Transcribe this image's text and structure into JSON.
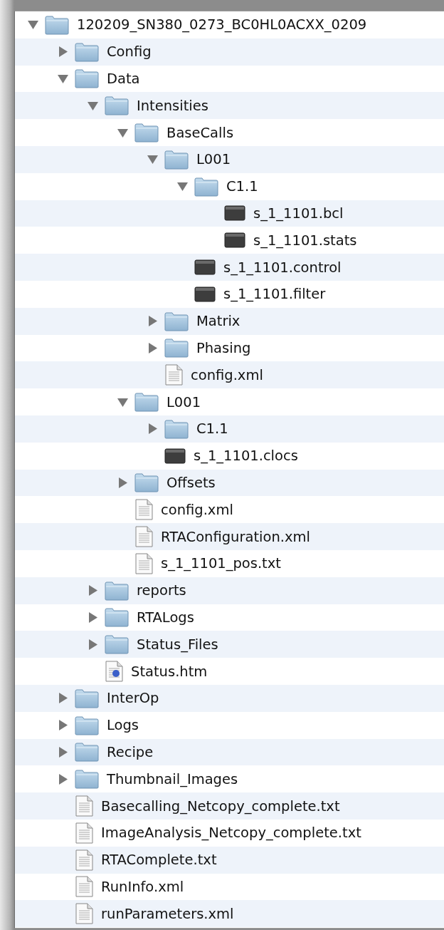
{
  "tree": [
    {
      "name": "120209_SN380_0273_BC0HL0ACXX_0209",
      "kind": "folder",
      "expanded": true,
      "children": [
        {
          "name": "Config",
          "kind": "folder",
          "expanded": false
        },
        {
          "name": "Data",
          "kind": "folder",
          "expanded": true,
          "children": [
            {
              "name": "Intensities",
              "kind": "folder",
              "expanded": true,
              "children": [
                {
                  "name": "BaseCalls",
                  "kind": "folder",
                  "expanded": true,
                  "children": [
                    {
                      "name": "L001",
                      "kind": "folder",
                      "expanded": true,
                      "children": [
                        {
                          "name": "C1.1",
                          "kind": "folder",
                          "expanded": true,
                          "children": [
                            {
                              "name": "s_1_1101.bcl",
                              "kind": "binary"
                            },
                            {
                              "name": "s_1_1101.stats",
                              "kind": "binary"
                            }
                          ]
                        },
                        {
                          "name": "s_1_1101.control",
                          "kind": "binary"
                        },
                        {
                          "name": "s_1_1101.filter",
                          "kind": "binary"
                        }
                      ]
                    },
                    {
                      "name": "Matrix",
                      "kind": "folder",
                      "expanded": false
                    },
                    {
                      "name": "Phasing",
                      "kind": "folder",
                      "expanded": false
                    },
                    {
                      "name": "config.xml",
                      "kind": "text"
                    }
                  ]
                },
                {
                  "name": "L001",
                  "kind": "folder",
                  "expanded": true,
                  "children": [
                    {
                      "name": "C1.1",
                      "kind": "folder",
                      "expanded": false
                    },
                    {
                      "name": "s_1_1101.clocs",
                      "kind": "binary"
                    }
                  ]
                },
                {
                  "name": "Offsets",
                  "kind": "folder",
                  "expanded": false
                },
                {
                  "name": "config.xml",
                  "kind": "text"
                },
                {
                  "name": "RTAConfiguration.xml",
                  "kind": "text"
                },
                {
                  "name": "s_1_1101_pos.txt",
                  "kind": "text"
                }
              ]
            },
            {
              "name": "reports",
              "kind": "folder",
              "expanded": false
            },
            {
              "name": "RTALogs",
              "kind": "folder",
              "expanded": false
            },
            {
              "name": "Status_Files",
              "kind": "folder",
              "expanded": false
            },
            {
              "name": "Status.htm",
              "kind": "web"
            }
          ]
        },
        {
          "name": "InterOp",
          "kind": "folder",
          "expanded": false
        },
        {
          "name": "Logs",
          "kind": "folder",
          "expanded": false
        },
        {
          "name": "Recipe",
          "kind": "folder",
          "expanded": false
        },
        {
          "name": "Thumbnail_Images",
          "kind": "folder",
          "expanded": false
        },
        {
          "name": "Basecalling_Netcopy_complete.txt",
          "kind": "text"
        },
        {
          "name": "ImageAnalysis_Netcopy_complete.txt",
          "kind": "text"
        },
        {
          "name": "RTAComplete.txt",
          "kind": "text"
        },
        {
          "name": "RunInfo.xml",
          "kind": "text"
        },
        {
          "name": "runParameters.xml",
          "kind": "text"
        }
      ]
    }
  ]
}
